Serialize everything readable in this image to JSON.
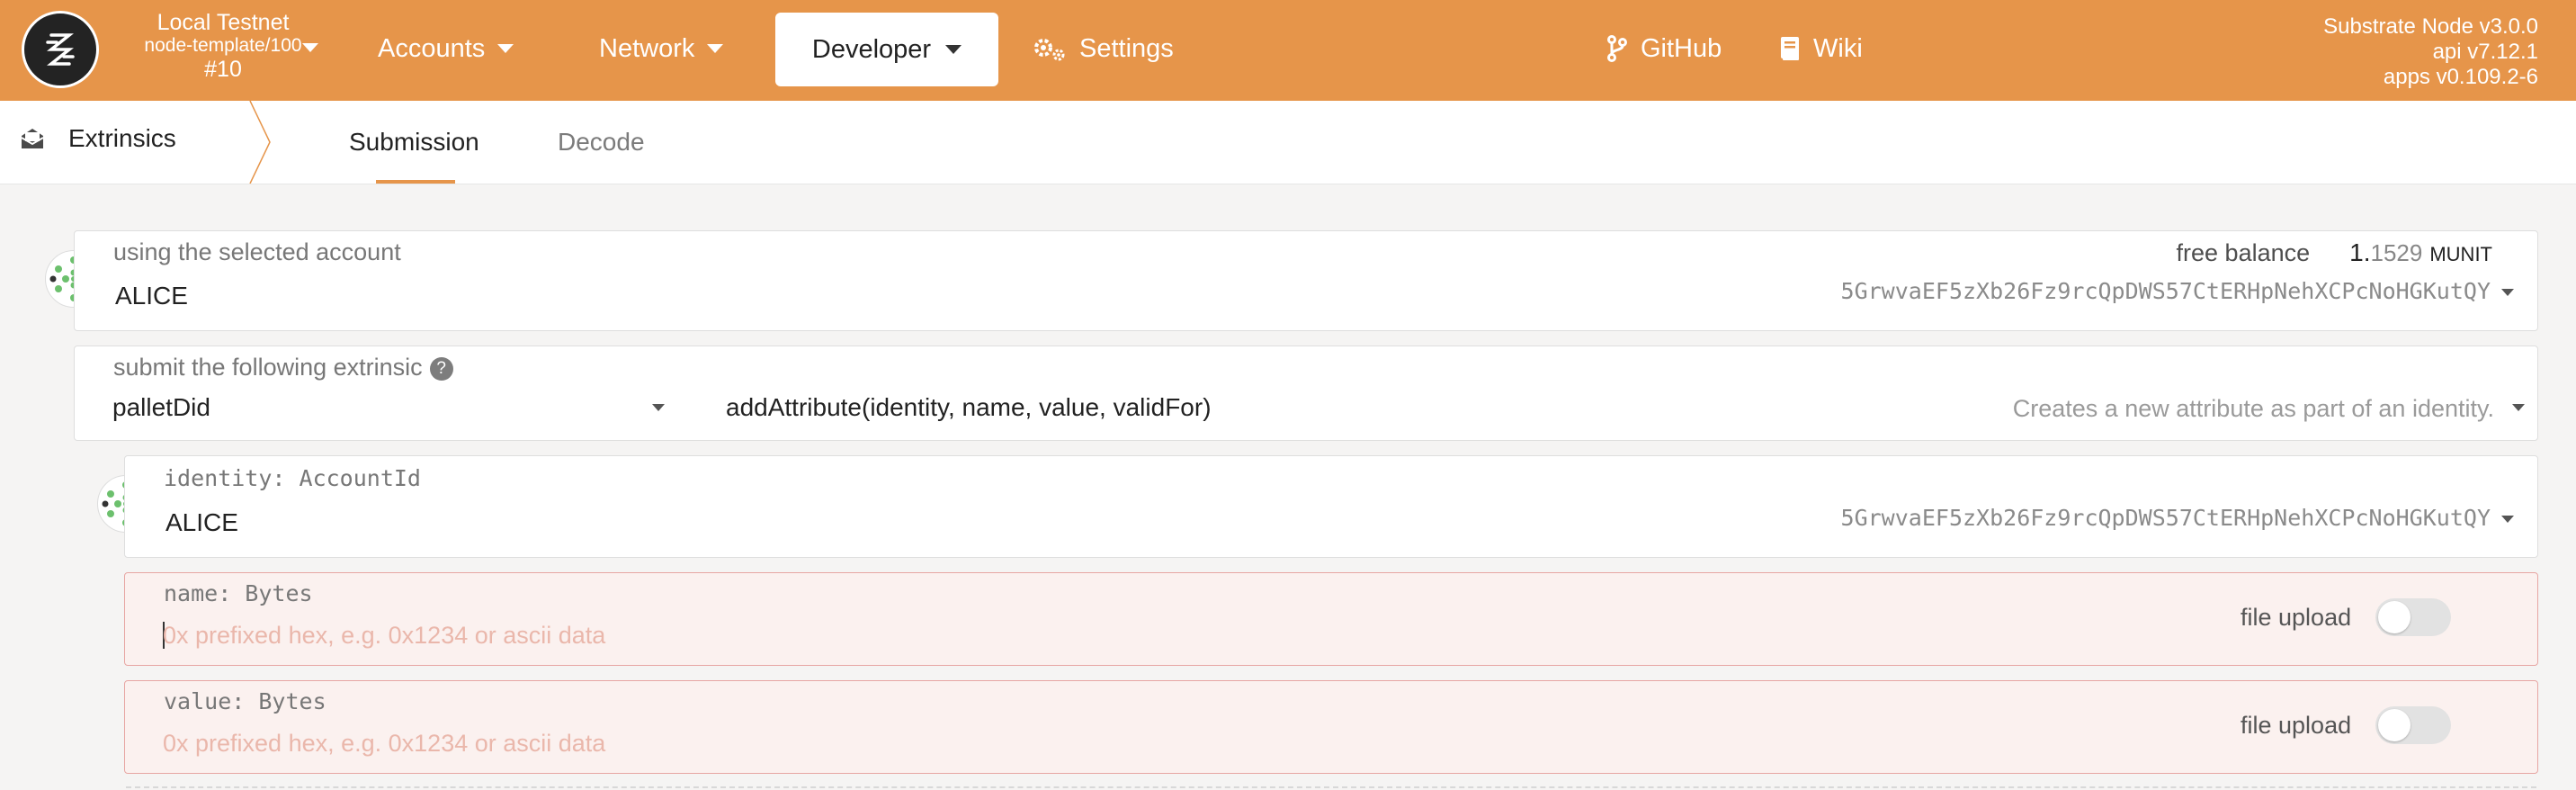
{
  "header": {
    "chain_name": "Local Testnet",
    "runtime": "node-template/100",
    "block": "#10",
    "nav": {
      "accounts": "Accounts",
      "network": "Network",
      "developer": "Developer",
      "settings": "Settings",
      "github": "GitHub",
      "wiki": "Wiki"
    },
    "version": {
      "node": "Substrate Node v3.0.0",
      "api": "api v7.12.1",
      "apps": "apps v0.109.2-6"
    }
  },
  "subnav": {
    "section": "Extrinsics",
    "tabs": [
      {
        "label": "Submission",
        "active": true
      },
      {
        "label": "Decode",
        "active": false
      }
    ]
  },
  "account": {
    "label": "using the selected account",
    "name": "ALICE",
    "address": "5GrwvaEF5zXb26Fz9rcQpDWS57CtERHpNehXCPcNoHGKutQY",
    "balance_label": "free balance",
    "balance_int": "1.",
    "balance_dec": "1529",
    "balance_unit": "MUNIT"
  },
  "extrinsic": {
    "label": "submit the following extrinsic",
    "help": "?",
    "pallet": "palletDid",
    "method": "addAttribute(identity, name, value, validFor)",
    "description": "Creates a new attribute as part of an identity."
  },
  "params": {
    "identity": {
      "label": "identity: AccountId",
      "name": "ALICE",
      "address": "5GrwvaEF5zXb26Fz9rcQpDWS57CtERHpNehXCPcNoHGKutQY"
    },
    "name": {
      "label": "name: Bytes",
      "placeholder": "0x prefixed hex, e.g. 0x1234 or ascii data",
      "file_upload": "file upload",
      "file_upload_on": false
    },
    "value": {
      "label": "value: Bytes",
      "placeholder": "0x prefixed hex, e.g. 0x1234 or ascii data",
      "file_upload": "file upload",
      "file_upload_on": false
    }
  },
  "colors": {
    "accent": "#e6954a",
    "error_bg": "#fbf1ef",
    "error_border": "#e7a6a3"
  }
}
